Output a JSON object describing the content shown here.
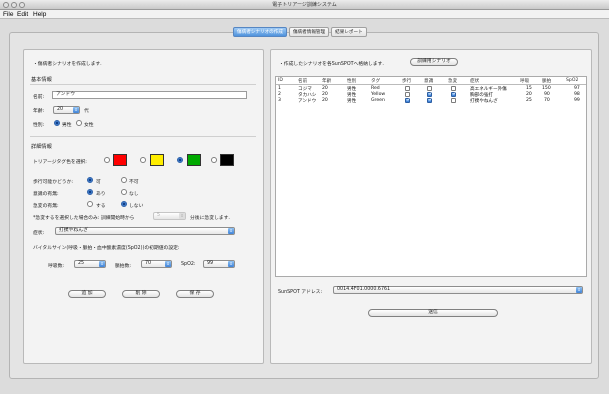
{
  "window": {
    "title": "電子トリアージ訓練システム"
  },
  "menu": {
    "file": "File",
    "edit": "Edit",
    "help": "Help"
  },
  "tabs": [
    {
      "label": "傷病者シナリオの作成",
      "active": true
    },
    {
      "label": "傷病者情報管理",
      "active": false
    },
    {
      "label": "結果レポート",
      "active": false
    }
  ],
  "left": {
    "intro": "・傷病者シナリオを作成します.",
    "basic_heading": "基本情報",
    "name_label": "名前:",
    "name_value": "アンドウ",
    "age_label": "年齢:",
    "age_value": "20",
    "age_unit": "代",
    "sex_label": "性別:",
    "sex_male": "男性",
    "sex_female": "女性",
    "detail_heading": "詳細情報",
    "tag_label": "トリアージタグ色を選択:",
    "tag_colors": [
      "#ff0000",
      "#ffee00",
      "#00aa00",
      "#000000"
    ],
    "walk_label": "歩行可能かどうか:",
    "walk_yes": "可",
    "walk_no": "不可",
    "conscious_label": "意識の有無:",
    "conscious_yes": "あり",
    "conscious_no": "なし",
    "sudden_label": "急変の有無:",
    "sudden_yes": "する",
    "sudden_no": "しない",
    "sudden_note_pre": "*急変するを選択した場合のみ: 訓練開始時から",
    "sudden_minutes": "5",
    "sudden_note_post": "分後に急変します.",
    "symptom_label": "症状:",
    "symptom_value": "打撲やねんざ",
    "vital_label": "バイタルサイン(呼吸・脈拍・血中酸素濃度(SpO2))の初期値の設定:",
    "resp_label": "呼吸数:",
    "resp_value": "25",
    "pulse_label": "脈拍数:",
    "pulse_value": "70",
    "spo2_label": "SpO2:",
    "spo2_value": "99",
    "add_button": "追 加",
    "delete_button": "削 除",
    "save_button": "保 存"
  },
  "right": {
    "intro": "・作成したシナリオを各SunSPOTへ格納します.",
    "training_button": "訓練用シナリオ",
    "columns": [
      "ID",
      "名前",
      "年齢",
      "性別",
      "タグ",
      "歩行",
      "意識",
      "急変",
      "症状",
      "呼吸",
      "脈拍",
      "SpO2"
    ],
    "rows": [
      {
        "id": "1",
        "name": "コジマ",
        "age": "20",
        "sex": "男性",
        "tag": "Red",
        "walk": false,
        "conscious": false,
        "sudden": false,
        "symptom": "高エネルギー外傷",
        "resp": "15",
        "pulse": "150",
        "spo2": "97"
      },
      {
        "id": "2",
        "name": "タカハシ",
        "age": "20",
        "sex": "男性",
        "tag": "Yellow",
        "walk": false,
        "conscious": true,
        "sudden": true,
        "symptom": "胸部の強打",
        "resp": "20",
        "pulse": "90",
        "spo2": "98"
      },
      {
        "id": "3",
        "name": "アンドウ",
        "age": "20",
        "sex": "男性",
        "tag": "Green",
        "walk": true,
        "conscious": true,
        "sudden": false,
        "symptom": "打撲やねんざ",
        "resp": "25",
        "pulse": "70",
        "spo2": "99"
      }
    ],
    "address_label": "SunSPOT アドレス:",
    "address_value": "0014.4F01.0000.6761",
    "send_button": "送信"
  }
}
